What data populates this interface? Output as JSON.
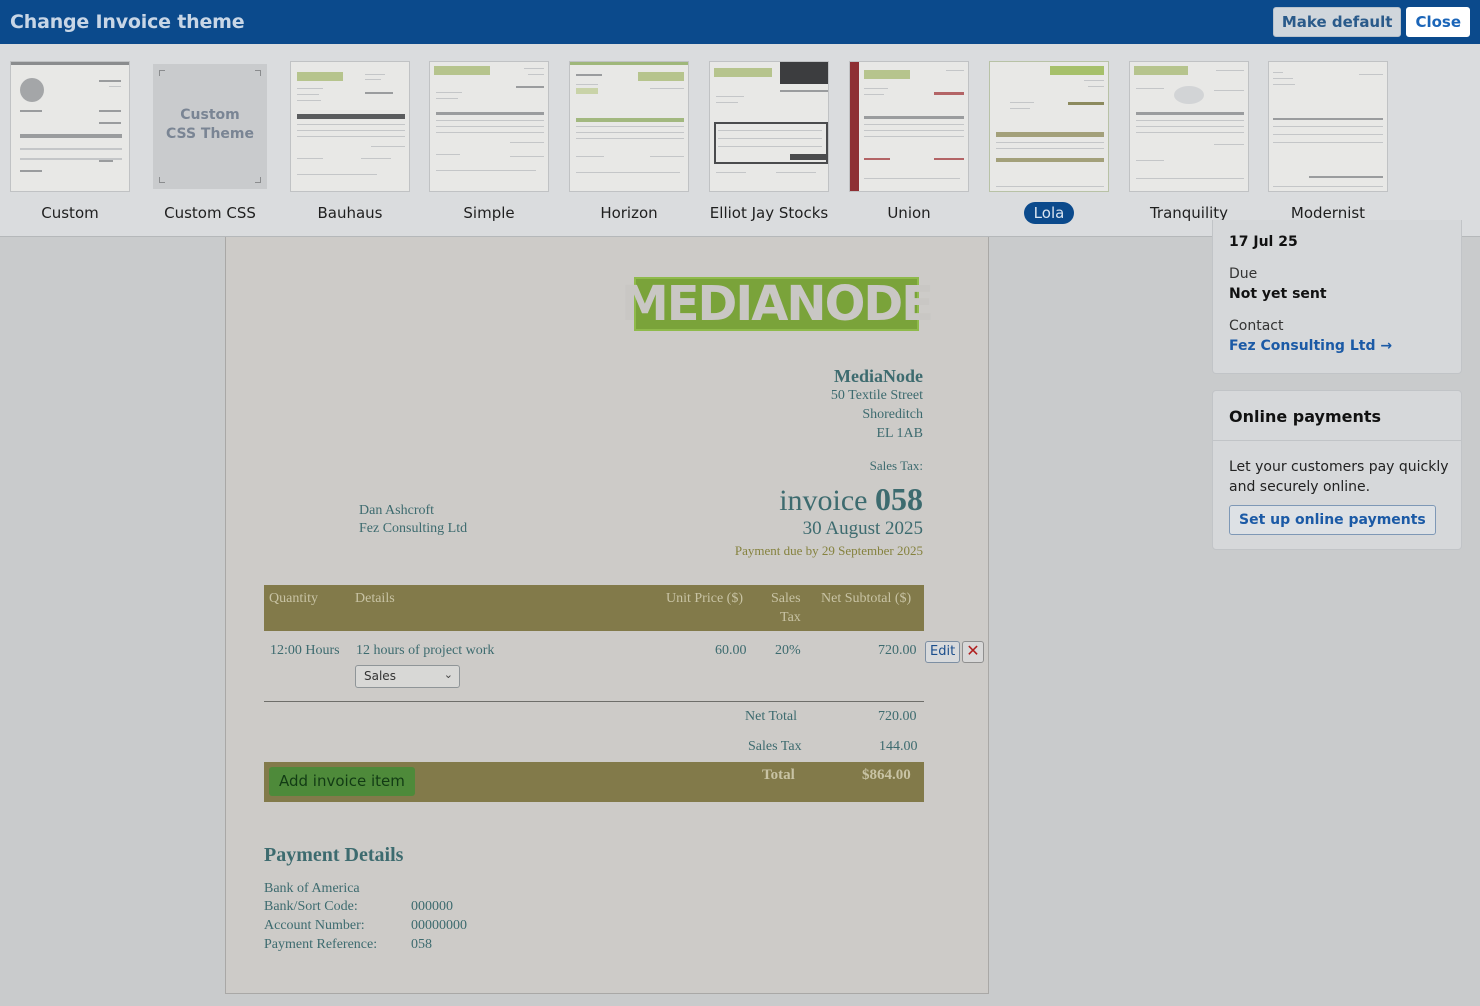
{
  "header": {
    "title": "Change Invoice theme",
    "make_default_label": "Make default",
    "close_label": "Close"
  },
  "themes": [
    {
      "label": "Custom"
    },
    {
      "label": "Custom CSS"
    },
    {
      "label": "Bauhaus"
    },
    {
      "label": "Simple"
    },
    {
      "label": "Horizon"
    },
    {
      "label": "Elliot Jay Stocks"
    },
    {
      "label": "Union"
    },
    {
      "label": "Lola",
      "selected": true
    },
    {
      "label": "Tranquility"
    },
    {
      "label": "Modernist"
    }
  ],
  "custom_css_thumb": {
    "line1": "Custom",
    "line2": "CSS Theme"
  },
  "invoice": {
    "logo": "MEDIANODE",
    "from": {
      "name": "MediaNode",
      "street": "50 Textile Street",
      "area": "Shoreditch",
      "postcode": "EL 1AB"
    },
    "sales_tax_label": "Sales Tax:",
    "to": {
      "contact": "Dan Ashcroft",
      "company": "Fez Consulting Ltd"
    },
    "word": "invoice",
    "number": "058",
    "date": "30 August 2025",
    "due": "Payment due by 29 September 2025",
    "columns": {
      "quantity": "Quantity",
      "details": "Details",
      "unit_price": "Unit Price ($)",
      "sales_tax_1": "Sales",
      "sales_tax_2": "Tax",
      "net_subtotal": "Net Subtotal ($)"
    },
    "items": [
      {
        "quantity": "12:00 Hours",
        "details": "12 hours of project work",
        "unit_price": "60.00",
        "tax": "20%",
        "subtotal": "720.00",
        "category": "Sales",
        "edit_label": "Edit",
        "delete_glyph": "✕"
      }
    ],
    "net_total_label": "Net Total",
    "net_total": "720.00",
    "sales_tax_row_label": "Sales Tax",
    "sales_tax_value": "144.00",
    "total_label": "Total",
    "total_value": "$864.00",
    "add_item_label": "Add invoice item",
    "payment": {
      "title": "Payment Details",
      "bank": "Bank of America",
      "sort_code_label": "Bank/Sort Code:",
      "sort_code": "000000",
      "account_label": "Account Number:",
      "account": "00000000",
      "reference_label": "Payment Reference:",
      "reference": "058"
    }
  },
  "sidebar": {
    "issued": "17 Jul 25",
    "due_label": "Due",
    "due_value": "Not yet sent",
    "contact_label": "Contact",
    "contact_link": "Fez Consulting Ltd →",
    "online_title": "Online payments",
    "online_text": "Let your customers pay quickly and securely online.",
    "online_button": "Set up online payments"
  },
  "colors": {
    "header_bg": "#0b4a8c",
    "invoice_accent": "#827a4a",
    "logo_green": "#7aa33a",
    "text_teal": "#3d6b6f"
  }
}
